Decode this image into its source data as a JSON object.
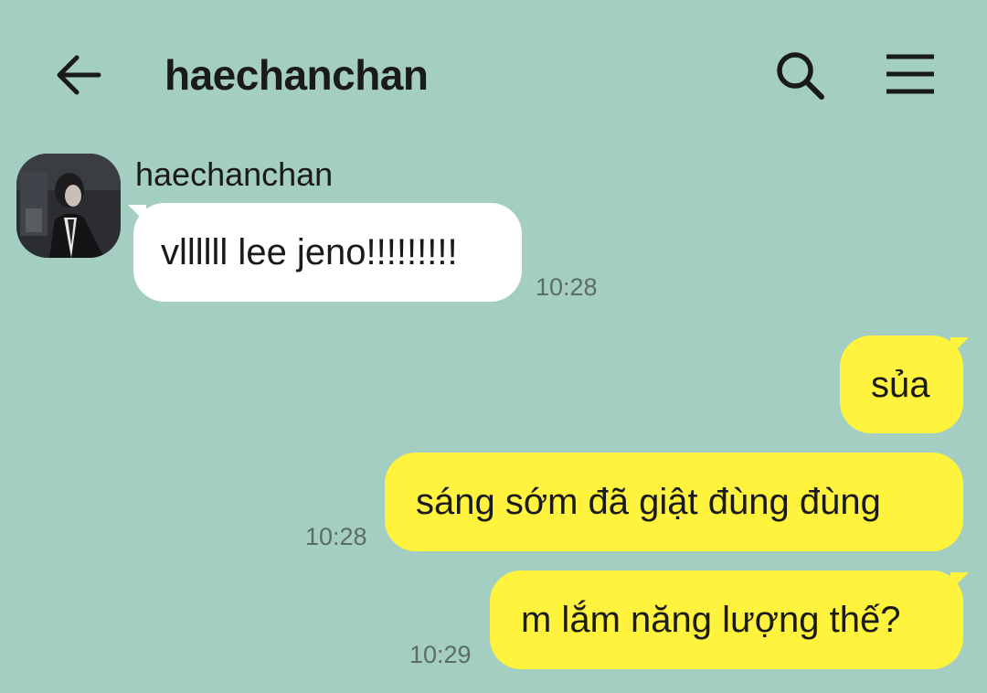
{
  "header": {
    "title": "haechanchan",
    "back_icon": "arrow-left-icon",
    "search_icon": "search-icon",
    "menu_icon": "hamburger-menu-icon"
  },
  "messages": [
    {
      "sender": "haechanchan",
      "direction": "incoming",
      "text": "vllllll lee jeno!!!!!!!!!",
      "time": "10:28"
    },
    {
      "direction": "outgoing",
      "text": "sủa",
      "time": ""
    },
    {
      "direction": "outgoing",
      "text": "sáng sớm đã giật đùng đùng",
      "time": "10:28"
    },
    {
      "direction": "outgoing",
      "text": "m lắm năng lượng thế?",
      "time": "10:29"
    }
  ],
  "colors": {
    "background": "#a5cec2",
    "incoming_bubble": "#ffffff",
    "outgoing_bubble": "#fff33d",
    "text": "#1a1a1a",
    "time": "#5a6d66"
  }
}
